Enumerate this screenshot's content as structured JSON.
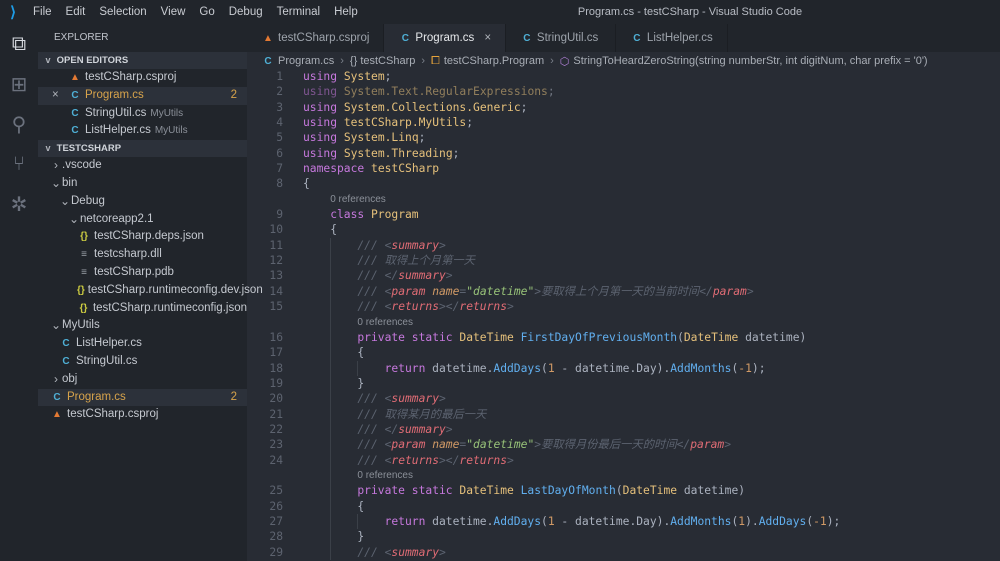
{
  "window": {
    "title": "Program.cs - testCSharp - Visual Studio Code"
  },
  "menu": [
    "File",
    "Edit",
    "Selection",
    "View",
    "Go",
    "Debug",
    "Terminal",
    "Help"
  ],
  "activity": [
    "files-icon",
    "extensions-icon",
    "search-icon",
    "source-control-icon",
    "debug-icon"
  ],
  "sidebar": {
    "title": "EXPLORER",
    "open_editors_label": "OPEN EDITORS",
    "open_editors": [
      {
        "icon": "rss",
        "label": "testCSharp.csproj",
        "desc": "",
        "badge": ""
      },
      {
        "icon": "cs",
        "label": "Program.cs",
        "desc": "",
        "badge": "2",
        "selected": true,
        "close": "×"
      },
      {
        "icon": "cs",
        "label": "StringUtil.cs",
        "desc": "MyUtils",
        "badge": ""
      },
      {
        "icon": "cs",
        "label": "ListHelper.cs",
        "desc": "MyUtils",
        "badge": ""
      }
    ],
    "project_label": "TESTCSHARP",
    "tree": [
      {
        "depth": 0,
        "chev": ">",
        "label": ".vscode"
      },
      {
        "depth": 0,
        "chev": "v",
        "label": "bin"
      },
      {
        "depth": 1,
        "chev": "v",
        "label": "Debug"
      },
      {
        "depth": 2,
        "chev": "v",
        "label": "netcoreapp2.1"
      },
      {
        "depth": 3,
        "icon": "json",
        "label": "testCSharp.deps.json"
      },
      {
        "depth": 3,
        "icon": "file",
        "label": "testcsharp.dll"
      },
      {
        "depth": 3,
        "icon": "file",
        "label": "testCSharp.pdb"
      },
      {
        "depth": 3,
        "icon": "json",
        "label": "testCSharp.runtimeconfig.dev.json"
      },
      {
        "depth": 3,
        "icon": "json",
        "label": "testCSharp.runtimeconfig.json"
      },
      {
        "depth": 0,
        "chev": "v",
        "label": "MyUtils"
      },
      {
        "depth": 1,
        "icon": "cs",
        "label": "ListHelper.cs"
      },
      {
        "depth": 1,
        "icon": "cs",
        "label": "StringUtil.cs"
      },
      {
        "depth": 0,
        "chev": ">",
        "label": "obj"
      },
      {
        "depth": 0,
        "icon": "cs",
        "label": "Program.cs",
        "badge": "2",
        "selected": true
      },
      {
        "depth": 0,
        "icon": "rss",
        "label": "testCSharp.csproj"
      }
    ]
  },
  "tabs": [
    {
      "icon": "rss",
      "label": "testCSharp.csproj"
    },
    {
      "icon": "cs",
      "label": "Program.cs",
      "active": true,
      "close": "×"
    },
    {
      "icon": "cs",
      "label": "StringUtil.cs"
    },
    {
      "icon": "cs",
      "label": "ListHelper.cs"
    }
  ],
  "breadcrumb": [
    "Program.cs",
    "{} testCSharp",
    "testCSharp.Program",
    "StringToHeardZeroString(string numberStr, int digitNum, char prefix = '0')"
  ],
  "code": [
    {
      "n": "1",
      "i": 0,
      "tk": [
        [
          "k",
          "using "
        ],
        [
          "t",
          "System"
        ],
        [
          "p",
          ";"
        ]
      ]
    },
    {
      "n": "2",
      "i": 0,
      "dim": true,
      "tk": [
        [
          "k",
          "using "
        ],
        [
          "t",
          "System.Text.RegularExpressions"
        ],
        [
          "p",
          ";"
        ]
      ]
    },
    {
      "n": "3",
      "i": 0,
      "tk": [
        [
          "k",
          "using "
        ],
        [
          "t",
          "System.Collections.Generic"
        ],
        [
          "p",
          ";"
        ]
      ]
    },
    {
      "n": "4",
      "i": 0,
      "tk": [
        [
          "k",
          "using "
        ],
        [
          "t",
          "testCSharp.MyUtils"
        ],
        [
          "p",
          ";"
        ]
      ]
    },
    {
      "n": "5",
      "i": 0,
      "tk": [
        [
          "k",
          "using "
        ],
        [
          "t",
          "System.Linq"
        ],
        [
          "p",
          ";"
        ]
      ]
    },
    {
      "n": "6",
      "i": 0,
      "tk": [
        [
          "k",
          "using "
        ],
        [
          "t",
          "System.Threading"
        ],
        [
          "p",
          ";"
        ]
      ]
    },
    {
      "n": "7",
      "i": 0,
      "tk": [
        [
          "k",
          "namespace "
        ],
        [
          "t",
          "testCSharp"
        ]
      ]
    },
    {
      "n": "8",
      "i": 0,
      "tk": [
        [
          "p",
          "{"
        ]
      ]
    },
    {
      "n": "",
      "i": 1,
      "ref": "0 references"
    },
    {
      "n": "9",
      "i": 1,
      "tk": [
        [
          "k",
          "class "
        ],
        [
          "t",
          "Program"
        ]
      ]
    },
    {
      "n": "10",
      "i": 1,
      "tk": [
        [
          "p",
          "{"
        ]
      ]
    },
    {
      "n": "11",
      "i": 2,
      "tk": [
        [
          "c",
          "/// "
        ],
        [
          "c",
          "<"
        ],
        [
          "x",
          "summary"
        ],
        [
          "c",
          ">"
        ]
      ]
    },
    {
      "n": "12",
      "i": 2,
      "tk": [
        [
          "c",
          "/// 取得上个月第一天"
        ]
      ]
    },
    {
      "n": "13",
      "i": 2,
      "tk": [
        [
          "c",
          "/// </"
        ],
        [
          "x",
          "summary"
        ],
        [
          "c",
          ">"
        ]
      ]
    },
    {
      "n": "14",
      "i": 2,
      "tk": [
        [
          "c",
          "/// <"
        ],
        [
          "x",
          "param"
        ],
        [
          "a",
          " name"
        ],
        [
          "c",
          "="
        ],
        [
          "s",
          "\"datetime\""
        ],
        [
          "c",
          ">要取得上个月第一天的当前时间</"
        ],
        [
          "x",
          "param"
        ],
        [
          "c",
          ">"
        ]
      ]
    },
    {
      "n": "15",
      "i": 2,
      "tk": [
        [
          "c",
          "/// <"
        ],
        [
          "x",
          "returns"
        ],
        [
          "c",
          "></"
        ],
        [
          "x",
          "returns"
        ],
        [
          "c",
          ">"
        ]
      ]
    },
    {
      "n": "",
      "i": 2,
      "ref": "0 references"
    },
    {
      "n": "16",
      "i": 2,
      "tk": [
        [
          "k",
          "private static "
        ],
        [
          "t",
          "DateTime "
        ],
        [
          "f",
          "FirstDayOfPreviousMonth"
        ],
        [
          "p",
          "("
        ],
        [
          "t",
          "DateTime"
        ],
        [
          "p",
          " datetime)"
        ]
      ]
    },
    {
      "n": "17",
      "i": 2,
      "tk": [
        [
          "p",
          "{"
        ]
      ]
    },
    {
      "n": "18",
      "i": 3,
      "tk": [
        [
          "k",
          "return "
        ],
        [
          "p",
          "datetime."
        ],
        [
          "f",
          "AddDays"
        ],
        [
          "p",
          "("
        ],
        [
          "n",
          "1"
        ],
        [
          "p",
          " - datetime.Day)."
        ],
        [
          "f",
          "AddMonths"
        ],
        [
          "p",
          "("
        ],
        [
          "n",
          "-1"
        ],
        [
          "p",
          ");"
        ]
      ]
    },
    {
      "n": "19",
      "i": 2,
      "tk": [
        [
          "p",
          "}"
        ]
      ]
    },
    {
      "n": "20",
      "i": 2,
      "tk": [
        [
          "c",
          "/// <"
        ],
        [
          "x",
          "summary"
        ],
        [
          "c",
          ">"
        ]
      ]
    },
    {
      "n": "21",
      "i": 2,
      "tk": [
        [
          "c",
          "/// 取得某月的最后一天"
        ]
      ]
    },
    {
      "n": "22",
      "i": 2,
      "tk": [
        [
          "c",
          "/// </"
        ],
        [
          "x",
          "summary"
        ],
        [
          "c",
          ">"
        ]
      ]
    },
    {
      "n": "23",
      "i": 2,
      "tk": [
        [
          "c",
          "/// <"
        ],
        [
          "x",
          "param"
        ],
        [
          "a",
          " name"
        ],
        [
          "c",
          "="
        ],
        [
          "s",
          "\"datetime\""
        ],
        [
          "c",
          ">要取得月份最后一天的时间</"
        ],
        [
          "x",
          "param"
        ],
        [
          "c",
          ">"
        ]
      ]
    },
    {
      "n": "24",
      "i": 2,
      "tk": [
        [
          "c",
          "/// <"
        ],
        [
          "x",
          "returns"
        ],
        [
          "c",
          "></"
        ],
        [
          "x",
          "returns"
        ],
        [
          "c",
          ">"
        ]
      ]
    },
    {
      "n": "",
      "i": 2,
      "ref": "0 references"
    },
    {
      "n": "25",
      "i": 2,
      "tk": [
        [
          "k",
          "private static "
        ],
        [
          "t",
          "DateTime "
        ],
        [
          "f",
          "LastDayOfMonth"
        ],
        [
          "p",
          "("
        ],
        [
          "t",
          "DateTime"
        ],
        [
          "p",
          " datetime)"
        ]
      ]
    },
    {
      "n": "26",
      "i": 2,
      "tk": [
        [
          "p",
          "{"
        ]
      ]
    },
    {
      "n": "27",
      "i": 3,
      "tk": [
        [
          "k",
          "return "
        ],
        [
          "p",
          "datetime."
        ],
        [
          "f",
          "AddDays"
        ],
        [
          "p",
          "("
        ],
        [
          "n",
          "1"
        ],
        [
          "p",
          " - datetime.Day)."
        ],
        [
          "f",
          "AddMonths"
        ],
        [
          "p",
          "("
        ],
        [
          "n",
          "1"
        ],
        [
          "p",
          ")."
        ],
        [
          "f",
          "AddDays"
        ],
        [
          "p",
          "("
        ],
        [
          "n",
          "-1"
        ],
        [
          "p",
          ");"
        ]
      ]
    },
    {
      "n": "28",
      "i": 2,
      "tk": [
        [
          "p",
          "}"
        ]
      ]
    },
    {
      "n": "29",
      "i": 2,
      "tk": [
        [
          "c",
          "/// <"
        ],
        [
          "x",
          "summary"
        ],
        [
          "c",
          ">"
        ]
      ]
    }
  ]
}
